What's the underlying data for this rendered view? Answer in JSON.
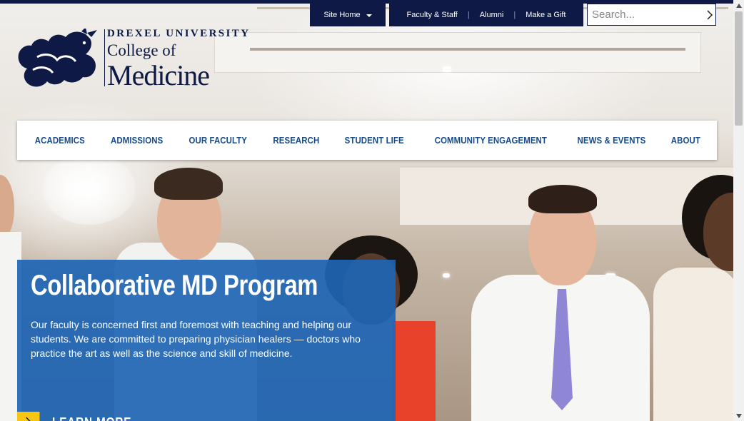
{
  "utility": {
    "site_home": "Site Home",
    "links": [
      {
        "label": "Faculty & Staff"
      },
      {
        "label": "Alumni"
      },
      {
        "label": "Make a Gift"
      }
    ],
    "separator": "|",
    "search_placeholder": "Search..."
  },
  "logo": {
    "university": "DREXEL UNIVERSITY",
    "line1": "College of",
    "line2": "Medicine"
  },
  "nav": {
    "items": [
      {
        "label": "ACADEMICS"
      },
      {
        "label": "ADMISSIONS"
      },
      {
        "label": "OUR FACULTY"
      },
      {
        "label": "RESEARCH"
      },
      {
        "label": "STUDENT LIFE"
      },
      {
        "label": "COMMUNITY ENGAGEMENT"
      },
      {
        "label": "NEWS & EVENTS"
      },
      {
        "label": "ABOUT"
      }
    ]
  },
  "hero": {
    "title": "Collaborative MD Program",
    "body": "Our faculty is concerned first and foremost with teaching and helping our students. We are committed to preparing physician healers — doctors who practice the art as well as the science and skill of medicine.",
    "cta": "LEARN MORE"
  },
  "colors": {
    "navy": "#0e1a45",
    "nav_text": "#174a8a",
    "card_blue": "#1e65b4",
    "accent_yellow": "#f7c612"
  },
  "icons": {
    "search": "chevron-right-icon",
    "site_home_caret": "caret-down-icon",
    "cta_arrow": "chevron-right-icon",
    "logo": "dragon-icon"
  }
}
